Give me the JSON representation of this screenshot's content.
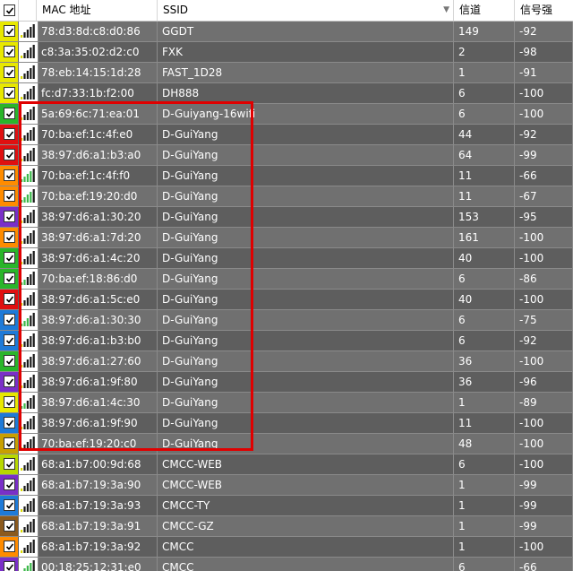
{
  "columns": {
    "mac": "MAC 地址",
    "ssid": "SSID",
    "channel": "信道",
    "signal": "信号强"
  },
  "colors": {
    "highlight": "#e00000",
    "signal_bar": "#3cb84a",
    "signal_bar_weak": "#d8d800"
  },
  "rows": [
    {
      "color": "#e8e800",
      "mac": "78:d3:8d:c8:d0:86",
      "ssid": "GGDT",
      "channel": "149",
      "signal": "-92"
    },
    {
      "color": "#e8e800",
      "mac": "c8:3a:35:02:d2:c0",
      "ssid": "FXK",
      "channel": "2",
      "signal": "-98"
    },
    {
      "color": "#e8e800",
      "mac": "78:eb:14:15:1d:28",
      "ssid": "FAST_1D28",
      "channel": "1",
      "signal": "-91"
    },
    {
      "color": "#e8e800",
      "mac": "fc:d7:33:1b:f2:00",
      "ssid": "DH888",
      "channel": "6",
      "signal": "-100"
    },
    {
      "color": "#2ab52a",
      "mac": "5a:69:6c:71:ea:01",
      "ssid": "D-Guiyang-16wifi",
      "channel": "6",
      "signal": "-100"
    },
    {
      "color": "#e01010",
      "mac": "70:ba:ef:1c:4f:e0",
      "ssid": "D-GuiYang",
      "channel": "44",
      "signal": "-92"
    },
    {
      "color": "#e01010",
      "mac": "38:97:d6:a1:b3:a0",
      "ssid": "D-GuiYang",
      "channel": "64",
      "signal": "-99"
    },
    {
      "color": "#ff8c00",
      "mac": "70:ba:ef:1c:4f:f0",
      "ssid": "D-GuiYang",
      "channel": "11",
      "signal": "-66"
    },
    {
      "color": "#ff8c00",
      "mac": "70:ba:ef:19:20:d0",
      "ssid": "D-GuiYang",
      "channel": "11",
      "signal": "-67"
    },
    {
      "color": "#7a2fc8",
      "mac": "38:97:d6:a1:30:20",
      "ssid": "D-GuiYang",
      "channel": "153",
      "signal": "-95"
    },
    {
      "color": "#ff8c00",
      "mac": "38:97:d6:a1:7d:20",
      "ssid": "D-GuiYang",
      "channel": "161",
      "signal": "-100"
    },
    {
      "color": "#2ab52a",
      "mac": "38:97:d6:a1:4c:20",
      "ssid": "D-GuiYang",
      "channel": "40",
      "signal": "-100"
    },
    {
      "color": "#2ab52a",
      "mac": "70:ba:ef:18:86:d0",
      "ssid": "D-GuiYang",
      "channel": "6",
      "signal": "-86"
    },
    {
      "color": "#e01010",
      "mac": "38:97:d6:a1:5c:e0",
      "ssid": "D-GuiYang",
      "channel": "40",
      "signal": "-100"
    },
    {
      "color": "#1e7ad8",
      "mac": "38:97:d6:a1:30:30",
      "ssid": "D-GuiYang",
      "channel": "6",
      "signal": "-75"
    },
    {
      "color": "#1e7ad8",
      "mac": "38:97:d6:a1:b3:b0",
      "ssid": "D-GuiYang",
      "channel": "6",
      "signal": "-92"
    },
    {
      "color": "#2ab52a",
      "mac": "38:97:d6:a1:27:60",
      "ssid": "D-GuiYang",
      "channel": "36",
      "signal": "-100"
    },
    {
      "color": "#7a2fc8",
      "mac": "38:97:d6:a1:9f:80",
      "ssid": "D-GuiYang",
      "channel": "36",
      "signal": "-96"
    },
    {
      "color": "#e8e800",
      "mac": "38:97:d6:a1:4c:30",
      "ssid": "D-GuiYang",
      "channel": "1",
      "signal": "-89"
    },
    {
      "color": "#1e7ad8",
      "mac": "38:97:d6:a1:9f:90",
      "ssid": "D-GuiYang",
      "channel": "11",
      "signal": "-100"
    },
    {
      "color": "#c8a000",
      "mac": "70:ba:ef:19:20:c0",
      "ssid": "D-GuiYang",
      "channel": "48",
      "signal": "-100"
    },
    {
      "color": "#b8d800",
      "mac": "68:a1:b7:00:9d:68",
      "ssid": "CMCC-WEB",
      "channel": "6",
      "signal": "-100"
    },
    {
      "color": "#7a2fc8",
      "mac": "68:a1:b7:19:3a:90",
      "ssid": "CMCC-WEB",
      "channel": "1",
      "signal": "-99"
    },
    {
      "color": "#1e7ad8",
      "mac": "68:a1:b7:19:3a:93",
      "ssid": "CMCC-TY",
      "channel": "1",
      "signal": "-99"
    },
    {
      "color": "#8b5a1e",
      "mac": "68:a1:b7:19:3a:91",
      "ssid": "CMCC-GZ",
      "channel": "1",
      "signal": "-99"
    },
    {
      "color": "#ff8c00",
      "mac": "68:a1:b7:19:3a:92",
      "ssid": "CMCC",
      "channel": "1",
      "signal": "-100"
    },
    {
      "color": "#7a2fc8",
      "mac": "00:18:25:12:31:e0",
      "ssid": "CMCC",
      "channel": "6",
      "signal": "-66"
    }
  ]
}
